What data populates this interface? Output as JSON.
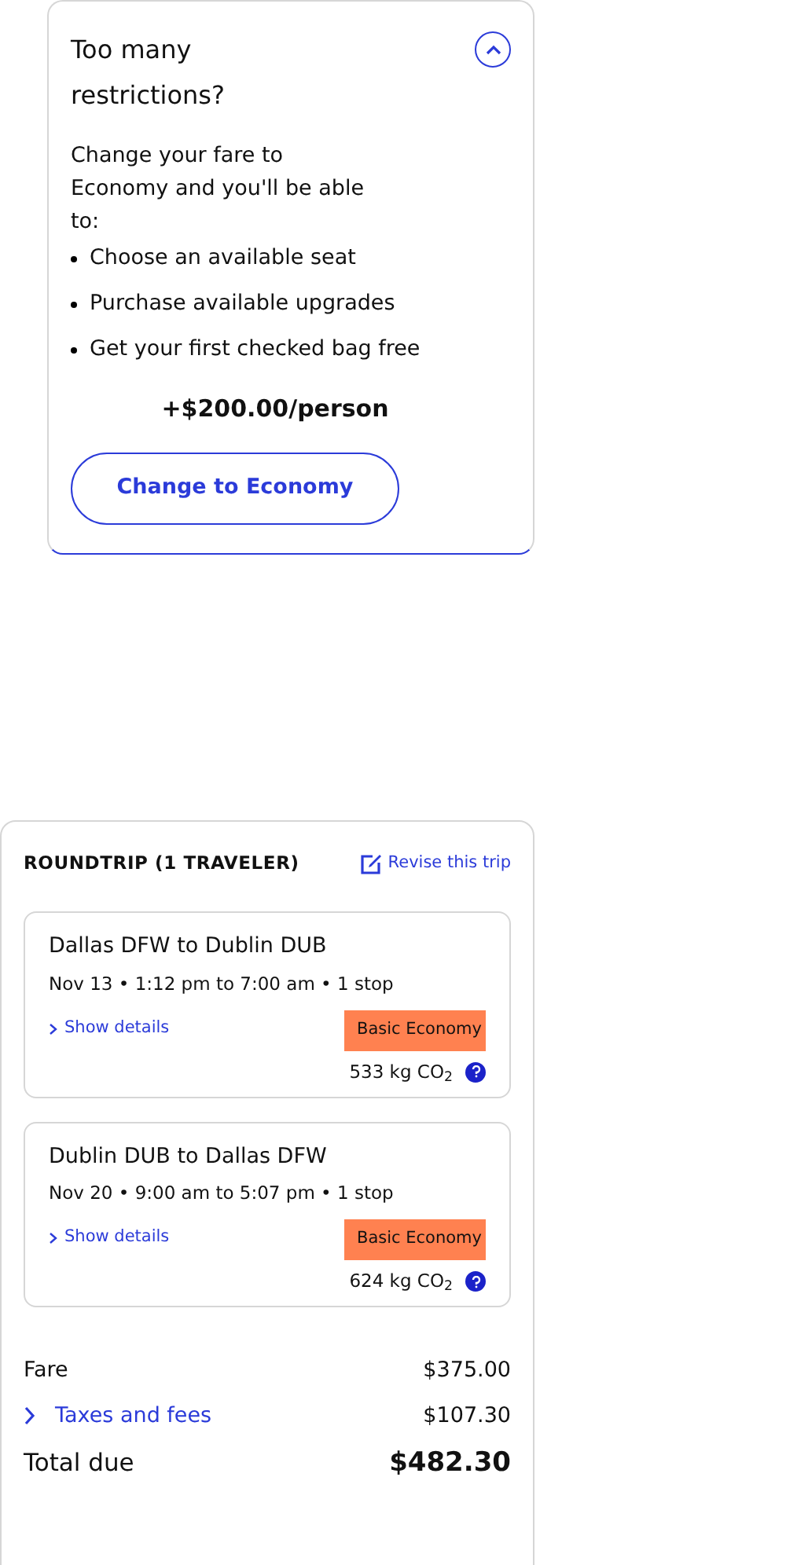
{
  "upgrade_panel": {
    "title": "Too many restrictions?",
    "expanded": true,
    "intro": "Change your fare to Economy and you'll be able to:",
    "benefits": [
      "Choose an available seat",
      "Purchase available upgrades",
      "Get your first checked bag free"
    ],
    "price": "+$200.00/person",
    "button": "Change to Economy"
  },
  "trip_summary": {
    "heading": "ROUNDTRIP (1 TRAVELER)",
    "revise_link": "Revise this trip",
    "flights": [
      {
        "route": "Dallas DFW to Dublin DUB",
        "schedule": "Nov 13 • 1:12 pm to 7:00 am • 1 stop",
        "details_link": "Show details",
        "fare_badge": "Basic Economy",
        "emissions": "533 kg CO$_{2}$"
      },
      {
        "route": "Dublin DUB to Dallas DFW",
        "schedule": "Nov 20 • 9:00 am to 5:07 pm • 1 stop",
        "details_link": "Show details",
        "fare_badge": "Basic Economy",
        "emissions": "624 kg CO$_{2}$"
      }
    ],
    "fare": {
      "label": "Fare",
      "amount": "$375.00"
    },
    "taxes": {
      "label": "Taxes and fees",
      "amount": "$107.30"
    },
    "total": {
      "label": "Total due",
      "amount": "$482.30"
    }
  }
}
